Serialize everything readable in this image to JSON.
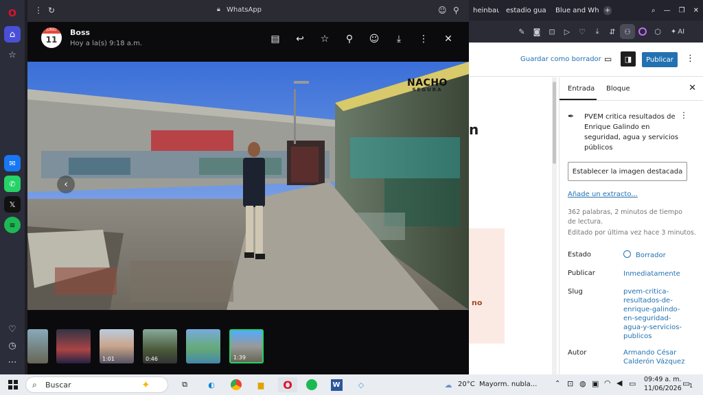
{
  "browser": {
    "tabs": [
      {
        "label": "heinbaum"
      },
      {
        "label": "estadio gua"
      },
      {
        "label": "Blue and Wh"
      }
    ],
    "new_tab_symbol": "+",
    "aria_label": "AI"
  },
  "whatsapp": {
    "window_title": "WhatsApp",
    "calendar": {
      "month": "JUNIO",
      "day": "11"
    },
    "sender": "Boss",
    "time": "Hoy a la(s) 9:18 a.m.",
    "watermark": {
      "line1": "NACHO",
      "line2": "SEGURA"
    },
    "thumbnails": [
      {
        "duration": ""
      },
      {
        "duration": ""
      },
      {
        "duration": "1:01"
      },
      {
        "duration": "0:46"
      },
      {
        "duration": ""
      },
      {
        "duration": "1:39"
      }
    ]
  },
  "wordpress": {
    "save_draft": "Guardar como borrador",
    "publish": "Publicar",
    "canvas_fragment_1": "n",
    "canvas_fragment_2": "no",
    "tab_post": "Entrada",
    "tab_block": "Bloque",
    "post_title": "PVEM critica resultados de Enrique Galindo en seguridad, agua y servicios públicos",
    "featured_image": "Establecer la imagen destacada",
    "add_excerpt": "Añade un extracto...",
    "word_count": "362 palabras, 2 minutos de tiempo de lectura.",
    "last_edited": "Editado por última vez hace 3 minutos.",
    "meta": [
      {
        "label": "Estado",
        "value": "Borrador"
      },
      {
        "label": "Publicar",
        "value": "Inmediatamente"
      },
      {
        "label": "Slug",
        "value": "pvem-critica-resultados-de-enrique-galindo-en-seguridad-agua-y-servicios-publicos"
      },
      {
        "label": "Autor",
        "value": "Armando César Calderón Vázquez"
      }
    ]
  },
  "taskbar": {
    "search_label": "Buscar",
    "weather": "20°C",
    "weather_desc": "Mayorm. nubla...",
    "time": "09:49 a. m.",
    "date": "11/06/2026",
    "notification_count": "1"
  },
  "colors": {
    "whatsapp_green": "#25d366",
    "wp_blue": "#2271b1",
    "opera_red": "#e0102a"
  }
}
